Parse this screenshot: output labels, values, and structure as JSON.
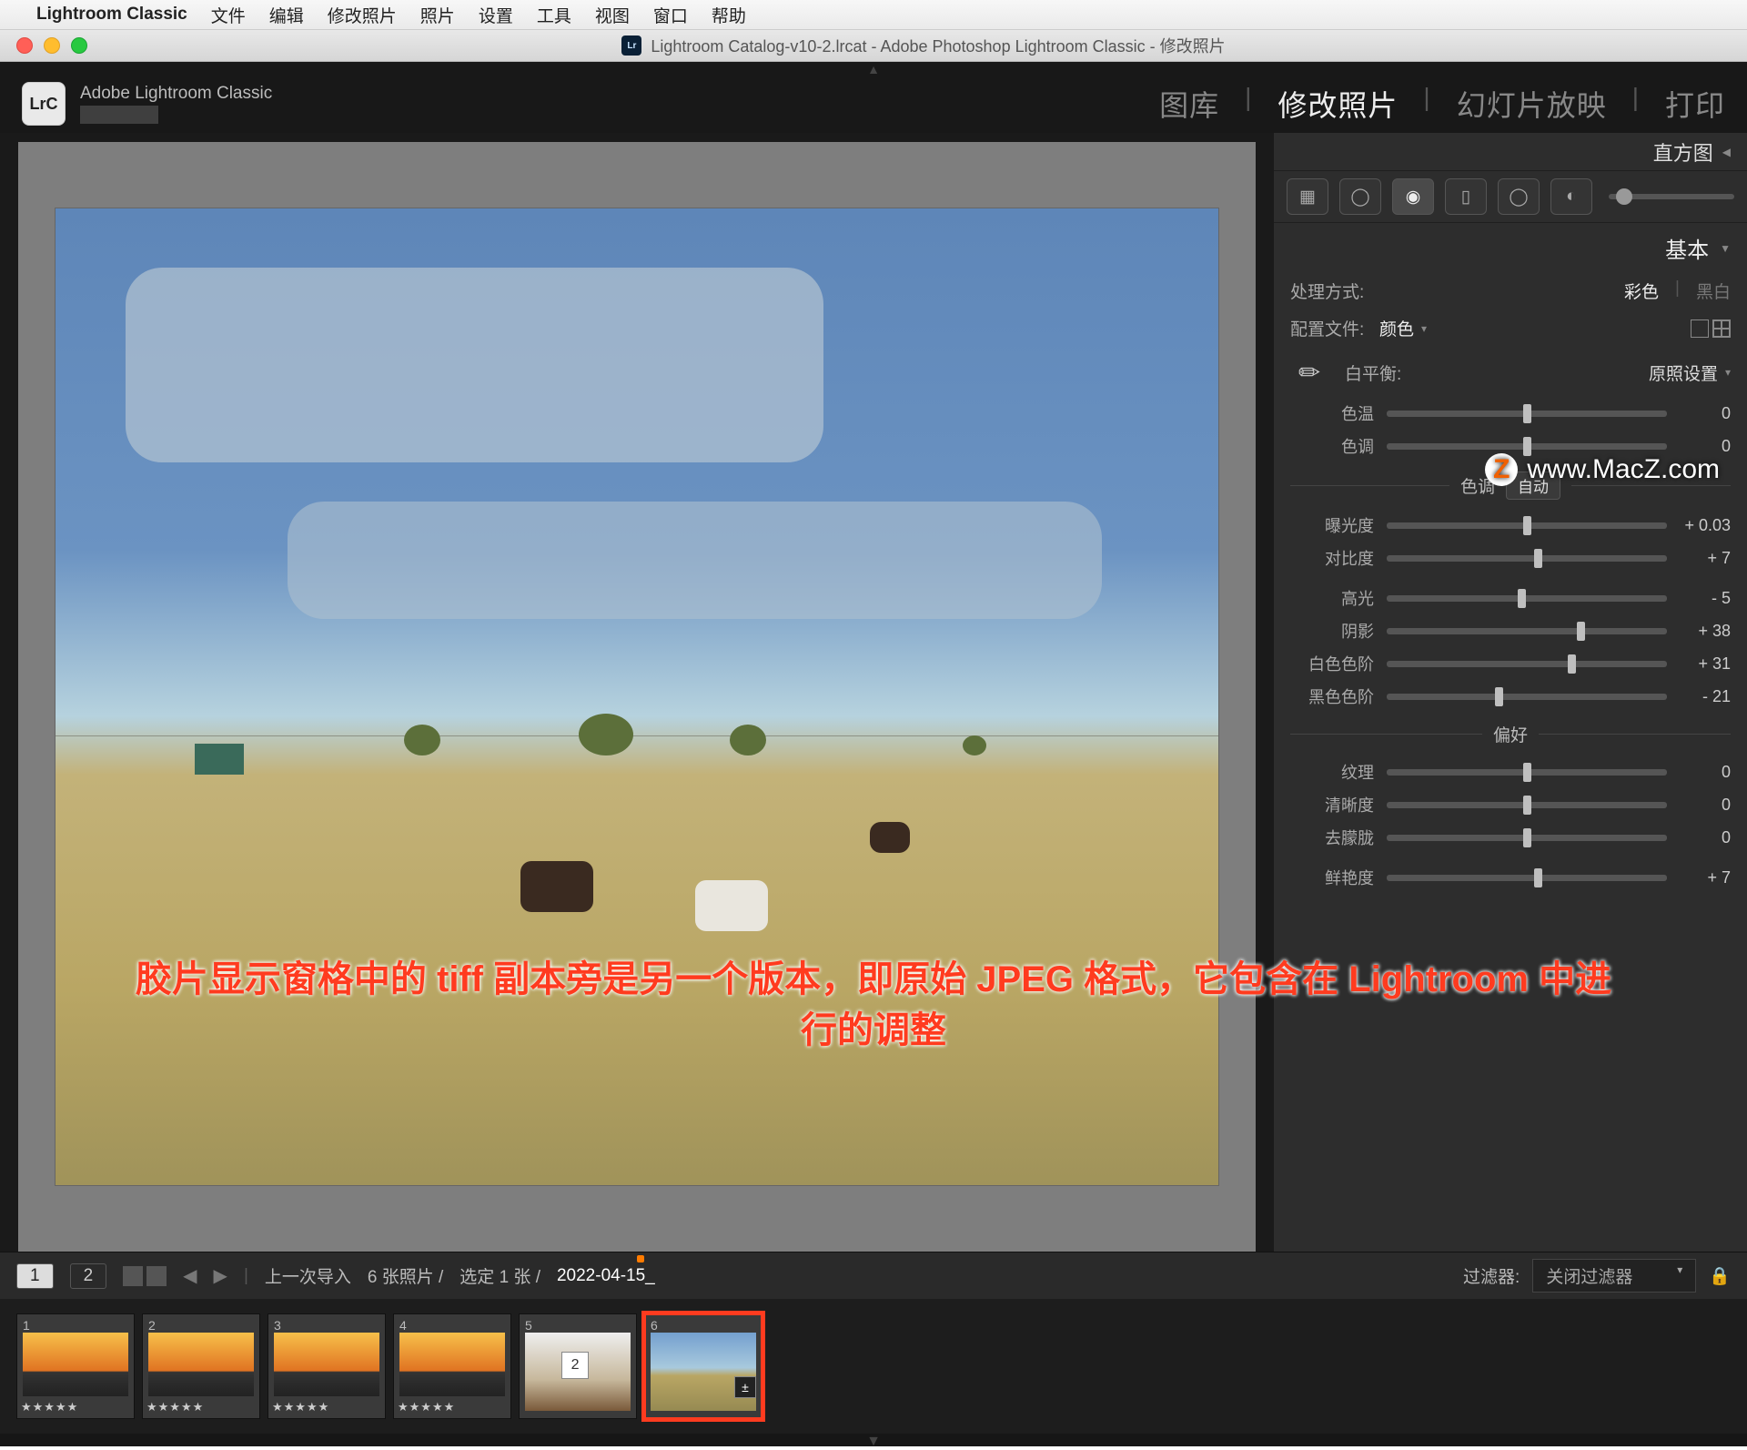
{
  "menubar": {
    "app": "Lightroom Classic",
    "items": [
      "文件",
      "编辑",
      "修改照片",
      "照片",
      "设置",
      "工具",
      "视图",
      "窗口",
      "帮助"
    ]
  },
  "window_title": "Lightroom Catalog-v10-2.lrcat - Adobe Photoshop Lightroom Classic - 修改照片",
  "identity": {
    "logo": "LrC",
    "brand": "Adobe Lightroom Classic"
  },
  "modules": {
    "library": "图库",
    "develop": "修改照片",
    "slideshow": "幻灯片放映",
    "print": "打印"
  },
  "panel": {
    "histogram": "直方图",
    "basic": "基本",
    "treatment_label": "处理方式:",
    "treatment_color": "彩色",
    "treatment_bw": "黑白",
    "profile_label": "配置文件:",
    "profile_value": "颜色",
    "wb_label": "白平衡:",
    "wb_value": "原照设置",
    "tone_title": "色调",
    "tone_auto": "自动",
    "presence_title": "偏好",
    "sliders": {
      "temp": {
        "label": "色温",
        "value": "0",
        "pos": 50,
        "barClass": "temp-bar"
      },
      "tint": {
        "label": "色调",
        "value": "0",
        "pos": 50,
        "barClass": "tint-bar"
      },
      "exposure": {
        "label": "曝光度",
        "value": "+ 0.03",
        "pos": 50
      },
      "contrast": {
        "label": "对比度",
        "value": "+ 7",
        "pos": 54
      },
      "highlights": {
        "label": "高光",
        "value": "- 5",
        "pos": 48
      },
      "shadows": {
        "label": "阴影",
        "value": "+ 38",
        "pos": 69
      },
      "whites": {
        "label": "白色色阶",
        "value": "+ 31",
        "pos": 66
      },
      "blacks": {
        "label": "黑色色阶",
        "value": "- 21",
        "pos": 40
      },
      "texture": {
        "label": "纹理",
        "value": "0",
        "pos": 50
      },
      "clarity": {
        "label": "清晰度",
        "value": "0",
        "pos": 50
      },
      "dehaze": {
        "label": "去朦胧",
        "value": "0",
        "pos": 50
      },
      "vibrance": {
        "label": "鲜艳度",
        "value": "+ 7",
        "pos": 54,
        "barClass": "vib-bar"
      }
    }
  },
  "toolbar": {
    "page1": "1",
    "page2": "2",
    "last_import": "上一次导入",
    "count": "6 张照片 /",
    "selected": "选定 1 张 /",
    "filename": "2022-04-15_",
    "filter_label": "过滤器:",
    "filter_value": "关闭过滤器"
  },
  "filmstrip": {
    "thumbs": [
      {
        "n": "1",
        "type": "sunset",
        "stars": "★★★★★"
      },
      {
        "n": "2",
        "type": "sunset",
        "stars": "★★★★★"
      },
      {
        "n": "3",
        "type": "sunset",
        "stars": "★★★★★"
      },
      {
        "n": "4",
        "type": "sunset",
        "stars": "★★★★★"
      },
      {
        "n": "5",
        "type": "room",
        "badge": "2"
      },
      {
        "n": "6",
        "type": "pasture",
        "selected": true,
        "dev": true
      }
    ]
  },
  "watermark": "www.MacZ.com",
  "annotation_line1": "胶片显示窗格中的 tiff 副本旁是另一个版本，即原始 JPEG 格式，它包含在 Lightroom 中进",
  "annotation_line2": "行的调整"
}
